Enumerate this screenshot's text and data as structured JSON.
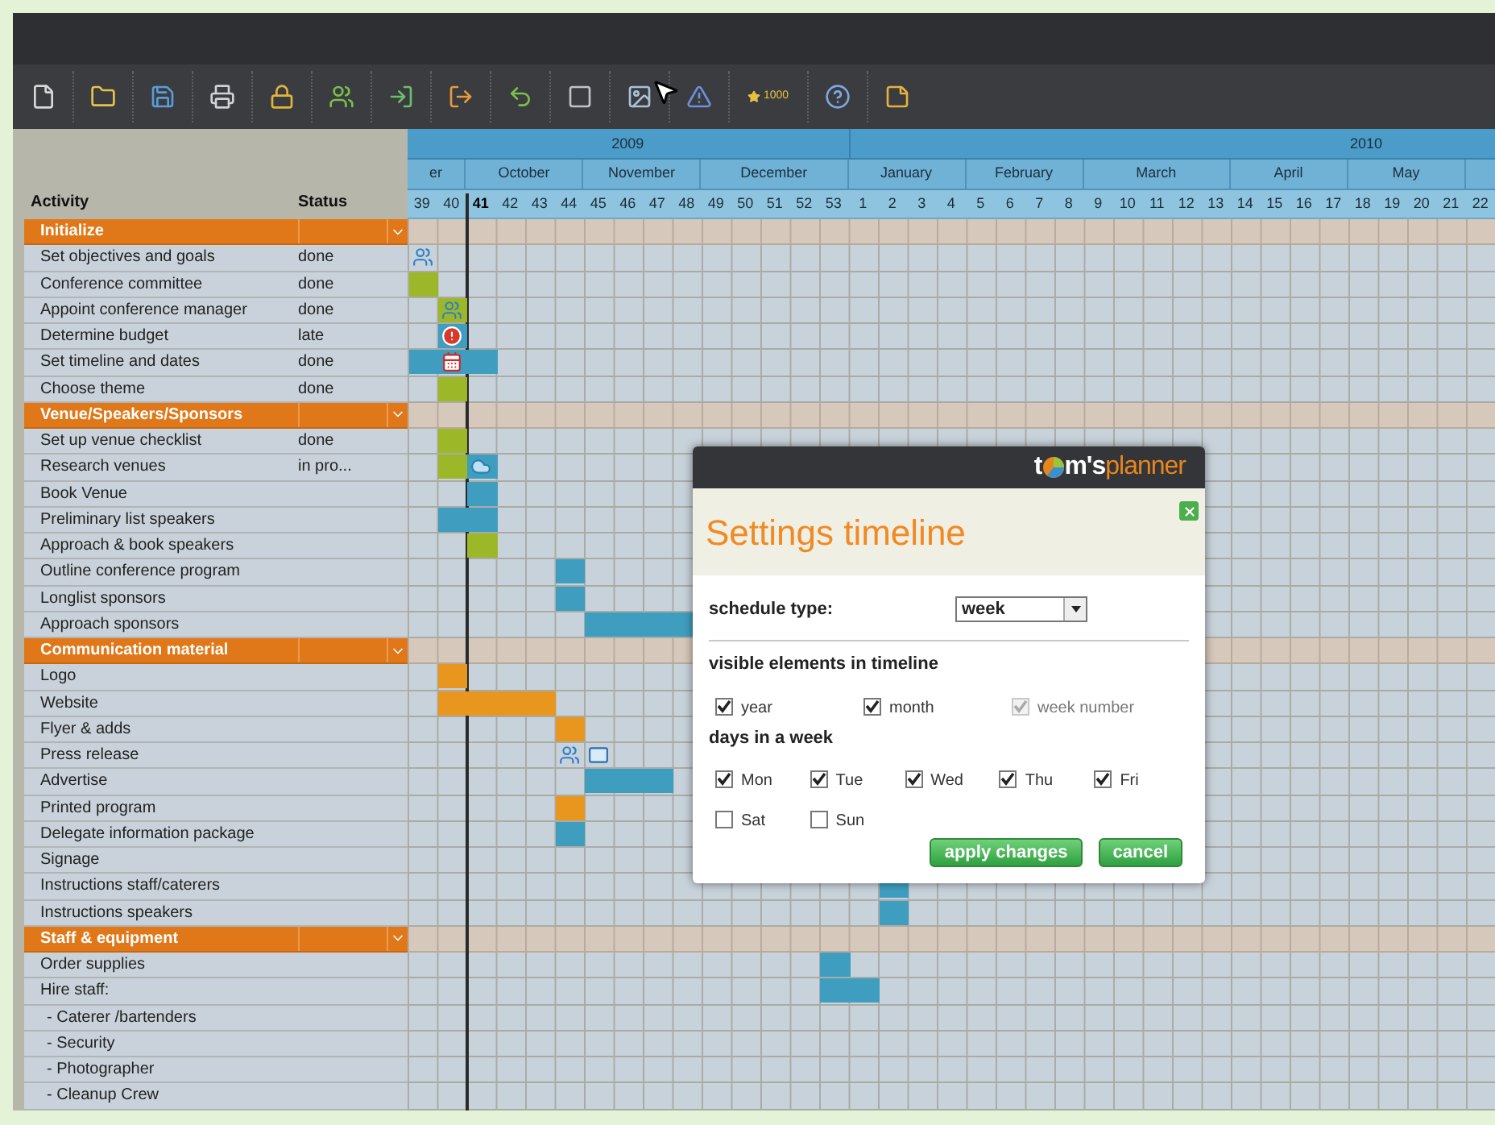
{
  "toolbar": [
    {
      "kind": "new"
    },
    {
      "kind": "open"
    },
    {
      "kind": "save"
    },
    {
      "kind": "print"
    },
    {
      "kind": "lock"
    },
    {
      "kind": "share"
    },
    {
      "kind": "import"
    },
    {
      "kind": "export"
    },
    {
      "kind": "undo"
    },
    {
      "kind": "blank"
    },
    {
      "kind": "image"
    },
    {
      "kind": "warning"
    },
    {
      "kind": "points",
      "label": "1000"
    },
    {
      "kind": "help"
    },
    {
      "kind": "notes"
    }
  ],
  "columns": [
    "Activity",
    "Status"
  ],
  "timeline": {
    "years": [
      {
        "label": "2009",
        "months": [
          {
            "label": "er",
            "weeks": [
              {
                "label": "39",
                "current": false
              },
              {
                "label": "40",
                "current": false
              }
            ]
          },
          {
            "label": "October",
            "weeks": [
              {
                "label": "41",
                "current": true
              },
              {
                "label": "42",
                "current": false
              },
              {
                "label": "43",
                "current": false
              },
              {
                "label": "44",
                "current": false
              }
            ]
          },
          {
            "label": "November",
            "weeks": [
              {
                "label": "45",
                "current": false
              },
              {
                "label": "46",
                "current": false
              },
              {
                "label": "47",
                "current": false
              },
              {
                "label": "48",
                "current": false
              }
            ]
          },
          {
            "label": "December",
            "weeks": [
              {
                "label": "49",
                "current": false
              },
              {
                "label": "50",
                "current": false
              },
              {
                "label": "51",
                "current": false
              },
              {
                "label": "52",
                "current": false
              },
              {
                "label": "53",
                "current": false
              }
            ]
          }
        ]
      },
      {
        "label": "2010",
        "months": [
          {
            "label": "January",
            "weeks": [
              {
                "label": "1",
                "current": false
              },
              {
                "label": "2",
                "current": false
              },
              {
                "label": "3",
                "current": false
              },
              {
                "label": "4",
                "current": false
              }
            ]
          },
          {
            "label": "February",
            "weeks": [
              {
                "label": "5",
                "current": false
              },
              {
                "label": "6",
                "current": false
              },
              {
                "label": "7",
                "current": false
              },
              {
                "label": "8",
                "current": false
              }
            ]
          },
          {
            "label": "March",
            "weeks": [
              {
                "label": "9",
                "current": false
              },
              {
                "label": "10",
                "current": false
              },
              {
                "label": "11",
                "current": false
              },
              {
                "label": "12",
                "current": false
              },
              {
                "label": "13",
                "current": false
              }
            ]
          },
          {
            "label": "April",
            "weeks": [
              {
                "label": "14",
                "current": false
              },
              {
                "label": "15",
                "current": false
              },
              {
                "label": "16",
                "current": false
              },
              {
                "label": "17",
                "current": false
              }
            ]
          },
          {
            "label": "May",
            "weeks": [
              {
                "label": "18",
                "current": false
              },
              {
                "label": "19",
                "current": false
              },
              {
                "label": "20",
                "current": false
              },
              {
                "label": "21",
                "current": false
              }
            ]
          },
          {
            "weeks": [
              {
                "label": "22",
                "current": false
              }
            ]
          }
        ]
      }
    ]
  },
  "groups": [
    {
      "title": "Initialize",
      "expanded": true,
      "tasks": [
        {
          "name": "Set objectives and goals",
          "status": "done",
          "cells": [
            {
              "kind": "people"
            }
          ]
        },
        {
          "name": "Conference committee",
          "status": "done",
          "cells": [
            {
              "color": "#9cb828"
            }
          ]
        },
        {
          "name": "Appoint conference manager",
          "status": "done",
          "cells": [
            null,
            {
              "kind": "people",
              "color": "#9cb828"
            }
          ]
        },
        {
          "name": "Determine budget",
          "status": "late",
          "cells": [
            null,
            {
              "kind": "alert",
              "color": "#3f9ec0"
            }
          ]
        },
        {
          "name": "Set timeline and dates",
          "status": "done",
          "cells": [
            {
              "color": "#3f9ec0"
            },
            {
              "kind": "calendar",
              "color": "#3f9ec0"
            },
            {
              "color": "#3f9ec0"
            }
          ]
        },
        {
          "name": "Choose theme",
          "status": "done",
          "cells": [
            null,
            {
              "color": "#9cb828"
            }
          ]
        }
      ]
    },
    {
      "title": "Venue/Speakers/Sponsors",
      "expanded": true,
      "tasks": [
        {
          "name": "Set up venue checklist",
          "status": "done",
          "cells": [
            null,
            {
              "color": "#9cb828"
            }
          ]
        },
        {
          "name": "Research venues",
          "status": "in pro...",
          "cells": [
            null,
            {
              "color": "#9cb828"
            },
            {
              "kind": "cloud",
              "color": "#3f9ec0"
            }
          ]
        },
        {
          "name": "Book Venue",
          "cells": [
            null,
            null,
            {
              "color": "#3f9ec0"
            }
          ]
        },
        {
          "name": "Preliminary list speakers",
          "cells": [
            null,
            {
              "color": "#3f9ec0"
            },
            {
              "color": "#3f9ec0"
            }
          ]
        },
        {
          "name": "Approach & book speakers",
          "cells": [
            null,
            null,
            {
              "color": "#9cb828"
            }
          ]
        },
        {
          "name": "Outline conference program",
          "cells": [
            null,
            null,
            null,
            null,
            null,
            {
              "color": "#3f9ec0"
            }
          ]
        },
        {
          "name": "Longlist sponsors",
          "cells": [
            null,
            null,
            null,
            null,
            null,
            {
              "color": "#3f9ec0"
            }
          ]
        },
        {
          "name": "Approach sponsors",
          "cells": [
            null,
            null,
            null,
            null,
            null,
            null,
            {
              "color": "#3f9ec0"
            },
            {
              "color": "#3f9ec0"
            },
            {
              "color": "#3f9ec0"
            },
            {
              "color": "#3f9ec0"
            }
          ]
        }
      ]
    },
    {
      "title": "Communication material",
      "expanded": true,
      "tasks": [
        {
          "name": "Logo",
          "cells": [
            null,
            {
              "color": "#e8961e"
            }
          ]
        },
        {
          "name": "Website",
          "cells": [
            null,
            {
              "color": "#e8961e"
            },
            {
              "color": "#e8961e"
            },
            {
              "color": "#e8961e"
            },
            {
              "color": "#e8961e"
            }
          ]
        },
        {
          "name": "Flyer & adds",
          "cells": [
            null,
            null,
            null,
            null,
            null,
            {
              "color": "#e8961e"
            }
          ]
        },
        {
          "name": "Press release",
          "cells": [
            null,
            null,
            null,
            null,
            null,
            {
              "kind": "people"
            },
            {
              "kind": "mail"
            }
          ]
        },
        {
          "name": "Advertise",
          "cells": [
            null,
            null,
            null,
            null,
            null,
            null,
            {
              "color": "#3f9ec0"
            },
            {
              "color": "#3f9ec0"
            },
            {
              "color": "#3f9ec0"
            }
          ]
        },
        {
          "name": "Printed program",
          "cells": [
            null,
            null,
            null,
            null,
            null,
            {
              "color": "#e8961e"
            }
          ]
        },
        {
          "name": "Delegate information package",
          "cells": [
            null,
            null,
            null,
            null,
            null,
            {
              "color": "#3f9ec0"
            }
          ]
        },
        {
          "name": "Signage"
        },
        {
          "name": "Instructions staff/caterers",
          "cells": [
            null,
            null,
            null,
            null,
            null,
            null,
            null,
            null,
            null,
            null,
            null,
            null,
            null,
            null,
            null,
            null,
            {
              "color": "#3f9ec0"
            }
          ]
        },
        {
          "name": "Instructions speakers",
          "cells": [
            null,
            null,
            null,
            null,
            null,
            null,
            null,
            null,
            null,
            null,
            null,
            null,
            null,
            null,
            null,
            null,
            {
              "color": "#3f9ec0"
            }
          ]
        }
      ]
    },
    {
      "title": "Staff & equipment",
      "expanded": true,
      "tasks": [
        {
          "name": "Order supplies",
          "cells": [
            null,
            null,
            null,
            null,
            null,
            null,
            null,
            null,
            null,
            null,
            null,
            null,
            null,
            null,
            {
              "color": "#3f9ec0"
            }
          ]
        },
        {
          "name": "Hire staff:",
          "cells": [
            null,
            null,
            null,
            null,
            null,
            null,
            null,
            null,
            null,
            null,
            null,
            null,
            null,
            null,
            {
              "color": "#3f9ec0"
            },
            {
              "color": "#3f9ec0"
            }
          ],
          "children": [
            {
              "name": "- Caterer /bartenders"
            },
            {
              "name": "- Security"
            },
            {
              "name": "- Photographer"
            },
            {
              "name": "- Cleanup Crew"
            }
          ]
        }
      ]
    }
  ],
  "dialog": {
    "logo": {
      "lead": "t",
      "middle": "m's",
      "tail": "planner"
    },
    "title": "Settings timeline",
    "schedule_type": {
      "label": "schedule type:",
      "value": "week"
    },
    "visible_heading": "visible elements in timeline",
    "visible": [
      {
        "label": "year",
        "checked": true,
        "disabled": false
      },
      {
        "label": "month",
        "checked": true,
        "disabled": false
      },
      {
        "label": "week number",
        "checked": true,
        "disabled": true
      }
    ],
    "days_heading": "days in a week",
    "days": [
      {
        "label": "Mon",
        "checked": true
      },
      {
        "label": "Tue",
        "checked": true
      },
      {
        "label": "Wed",
        "checked": true
      },
      {
        "label": "Thu",
        "checked": true
      },
      {
        "label": "Fri",
        "checked": true
      },
      {
        "label": "Sat",
        "checked": false
      },
      {
        "label": "Sun",
        "checked": false
      }
    ],
    "buttons": [
      "apply changes",
      "cancel"
    ]
  }
}
